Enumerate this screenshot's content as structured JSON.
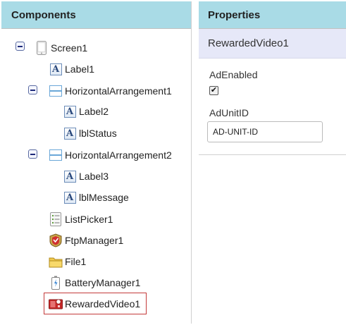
{
  "components": {
    "header": "Components",
    "tree": [
      {
        "label": "Screen1",
        "icon": "screen-icon"
      },
      {
        "label": "Label1",
        "icon": "label-icon"
      },
      {
        "label": "HorizontalArrangement1",
        "icon": "horizontal-arrangement-icon"
      },
      {
        "label": "Label2",
        "icon": "label-icon"
      },
      {
        "label": "lblStatus",
        "icon": "label-icon"
      },
      {
        "label": "HorizontalArrangement2",
        "icon": "horizontal-arrangement-icon"
      },
      {
        "label": "Label3",
        "icon": "label-icon"
      },
      {
        "label": "lblMessage",
        "icon": "label-icon"
      },
      {
        "label": "ListPicker1",
        "icon": "listpicker-icon"
      },
      {
        "label": "FtpManager1",
        "icon": "ftp-manager-icon"
      },
      {
        "label": "File1",
        "icon": "folder-icon"
      },
      {
        "label": "BatteryManager1",
        "icon": "battery-icon"
      },
      {
        "label": "RewardedVideo1",
        "icon": "rewarded-video-icon",
        "selected": true
      }
    ]
  },
  "properties": {
    "header": "Properties",
    "component_name": "RewardedVideo1",
    "ad_enabled_label": "AdEnabled",
    "ad_enabled_checked": true,
    "ad_enabled_glyph": "✔",
    "ad_unit_id_label": "AdUnitID",
    "ad_unit_id_value": "AD-UNIT-ID"
  },
  "colors": {
    "header_bg": "#a9dbe6",
    "selected_border": "#c43a3a",
    "component_bar_bg": "#e6e8f8"
  }
}
